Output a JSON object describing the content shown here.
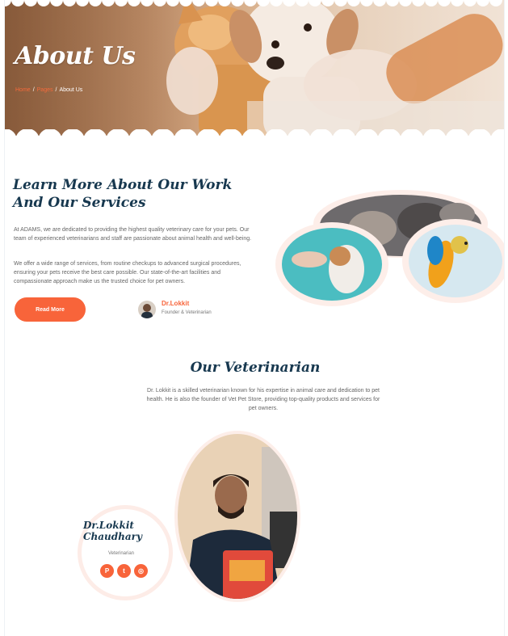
{
  "hero": {
    "title": "About Us",
    "breadcrumbs": [
      "Home",
      "Pages",
      "About Us"
    ],
    "separator": "/"
  },
  "about": {
    "title": "Learn More About Our Work And Our Services",
    "paragraphs": [
      "At ADAMS, we are dedicated to providing the highest quality veterinary care for your pets. Our team of experienced veterinarians and staff are passionate about animal health and well-being.",
      "We offer a wide range of services, from routine checkups to advanced surgical procedures, ensuring your pets receive the best care possible. Our state-of-the-art facilities and compassionate approach make us the trusted choice for pet owners."
    ],
    "read_more_label": "Read More",
    "author": {
      "name": "Dr.Lokkit",
      "role": "Founder & Veterinarian"
    }
  },
  "veterinarian": {
    "section_title": "Our Veterinarian",
    "description": "Dr. Lokkit is a skilled veterinarian known for his expertise in animal care and dedication to pet health. He is also the founder of Vet Pet Store, providing top-quality products and services for pet owners.",
    "card": {
      "name": "Dr.Lokkit Chaudhary",
      "role": "Veterinarian",
      "socials": [
        {
          "icon": "pinterest-icon",
          "glyph": "P"
        },
        {
          "icon": "twitter-icon",
          "glyph": "t"
        },
        {
          "icon": "instagram-icon",
          "glyph": "◎"
        }
      ]
    }
  },
  "colors": {
    "accent": "#f8643a",
    "heading": "#17384f",
    "body_text": "#666666"
  }
}
